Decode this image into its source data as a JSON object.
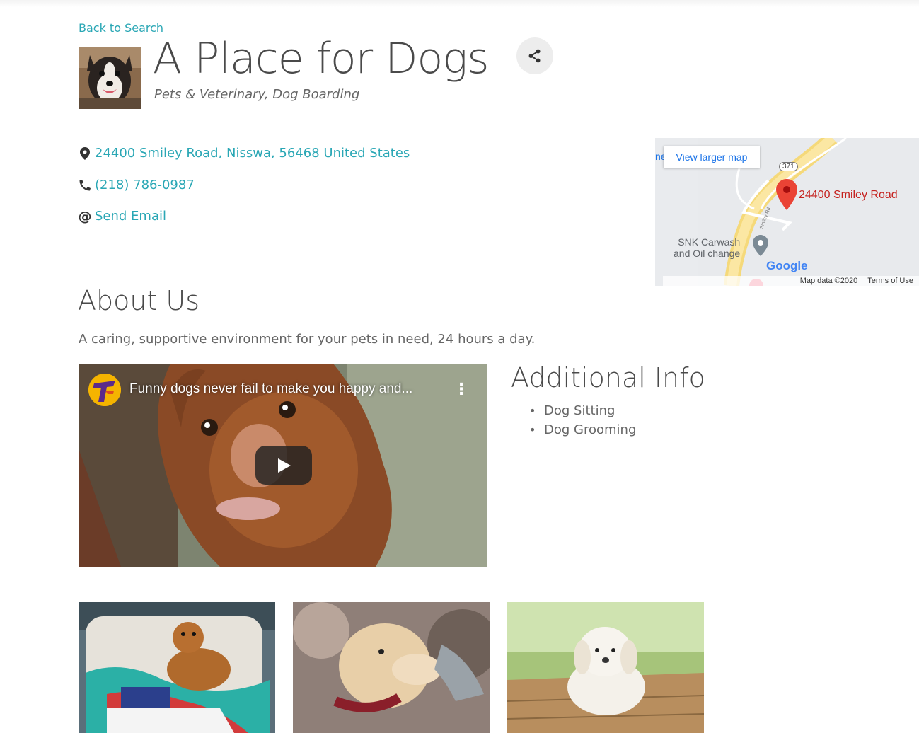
{
  "nav": {
    "back_label": "Back to Search"
  },
  "business": {
    "name": "A Place for Dogs",
    "categories": "Pets & Veterinary, Dog Boarding",
    "logo_icon": "dog-photo"
  },
  "contact": {
    "address": "24400 Smiley Road, Nisswa, 56468 United States",
    "phone": "(218) 786-0987",
    "email_label": "Send Email",
    "email_prefix": "@"
  },
  "map": {
    "view_larger_label": "View larger map",
    "edge_text": "ne",
    "pin_label": "24400 Smiley Road",
    "route_label": "371",
    "road_label": "Smiley Rd",
    "poi_label_line1": "SNK Carwash",
    "poi_label_line2": "and Oil change",
    "google_label": "Google",
    "attribution": "Map data ©2020",
    "terms_label": "Terms of Use"
  },
  "about": {
    "heading": "About Us",
    "text": "A caring, supportive environment for your pets in need, 24 hours a day."
  },
  "video": {
    "title": "Funny dogs never fail to make you happy and...",
    "channel_icon": "channel-avatar-icon"
  },
  "additional": {
    "heading": "Additional Info",
    "items": [
      "Dog Sitting",
      "Dog Grooming"
    ]
  },
  "colors": {
    "link": "#2aa7b5",
    "heading": "#4a4a4a",
    "map_pin": "#ea4335"
  }
}
